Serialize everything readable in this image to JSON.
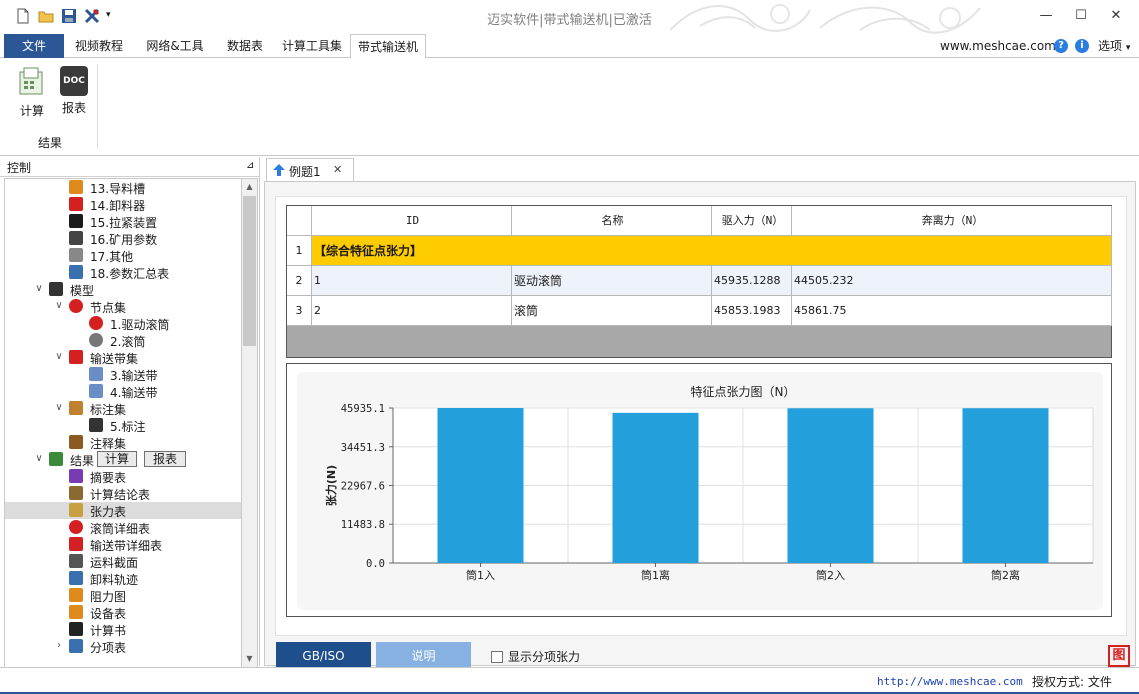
{
  "window": {
    "title": "迈实软件|带式输送机|已激活",
    "minimize": "—",
    "maximize": "☐",
    "close": "✕"
  },
  "ribbon": {
    "tabs": [
      "文件",
      "视频教程",
      "网络&工具",
      "数据表",
      "计算工具集",
      "带式输送机"
    ],
    "active_tab": "带式输送机",
    "website": "www.meshcae.com",
    "options_label": "选项",
    "options_arrow": "▾",
    "calc_label": "计算",
    "doc_label": "报表",
    "doc_icon_text": "DOC",
    "group_label": "结果"
  },
  "panel": {
    "title": "控制",
    "pin": "⊿",
    "tree": [
      {
        "label": "13.导料槽",
        "icon": "chute-icon"
      },
      {
        "label": "14.卸料器",
        "icon": "unloader-icon"
      },
      {
        "label": "15.拉紧装置",
        "icon": "tensioner-icon"
      },
      {
        "label": "16.矿用参数",
        "icon": "pickaxe-icon"
      },
      {
        "label": "17.其他",
        "icon": "diamond-icon"
      },
      {
        "label": "18.参数汇总表",
        "icon": "books-icon"
      },
      {
        "label": "模型",
        "icon": "grid-icon",
        "expander": "∨"
      },
      {
        "label": "节点集",
        "icon": "nodes-icon",
        "expander": "∨"
      },
      {
        "label": "1.驱动滚筒",
        "icon": "drive-pulley-icon"
      },
      {
        "label": "2.滚筒",
        "icon": "pulley-icon"
      },
      {
        "label": "输送带集",
        "icon": "belt-set-icon",
        "expander": "∨"
      },
      {
        "label": "3.输送带",
        "icon": "belt-icon"
      },
      {
        "label": "4.输送带",
        "icon": "belt-icon"
      },
      {
        "label": "标注集",
        "icon": "annotation-icon",
        "expander": "∨"
      },
      {
        "label": "5.标注",
        "icon": "dimension-icon"
      },
      {
        "label": "注释集",
        "icon": "note-icon"
      },
      {
        "label": "结果",
        "icon": "results-icon",
        "expander": "∨"
      },
      {
        "label": "摘要表",
        "icon": "summary-icon"
      },
      {
        "label": "计算结论表",
        "icon": "hammer-icon"
      },
      {
        "label": "张力表",
        "icon": "tension-icon"
      },
      {
        "label": "滚筒详细表",
        "icon": "red-circle-icon"
      },
      {
        "label": "输送带详细表",
        "icon": "red-bar-icon"
      },
      {
        "label": "运料截面",
        "icon": "section-icon"
      },
      {
        "label": "卸料轨迹",
        "icon": "trajectory-icon"
      },
      {
        "label": "阻力图",
        "icon": "resistance-icon"
      },
      {
        "label": "设备表",
        "icon": "equipment-icon"
      },
      {
        "label": "计算书",
        "icon": "pi-icon"
      },
      {
        "label": "分项表",
        "icon": "subtable-icon",
        "expander": "›"
      }
    ],
    "results_calc_btn": "计算",
    "results_report_btn": "报表",
    "selected_item": "张力表"
  },
  "document": {
    "tab_label": "例题1",
    "tab_close": "✕",
    "table": {
      "headers": [
        "ID",
        "名称",
        "驱入力（N）",
        "奔离力（N）"
      ],
      "rows": [
        {
          "num": "1",
          "id": "【综合特征点张力】",
          "name": "",
          "in": "",
          "out": ""
        },
        {
          "num": "2",
          "id": "1",
          "name": "驱动滚筒",
          "in": "45935.1288",
          "out": "44505.232"
        },
        {
          "num": "3",
          "id": "2",
          "name": "滚筒",
          "in": "45853.1983",
          "out": "45861.75"
        }
      ]
    },
    "gbiso_label": "GB/ISO",
    "explain_label": "说明",
    "show_sub_label": "显示分项张力",
    "corner_icon_text": "图"
  },
  "chart_data": {
    "type": "bar",
    "title": "特征点张力图（N）",
    "xlabel": "",
    "ylabel": "张力(N)",
    "categories": [
      "筒1入",
      "筒1离",
      "筒2入",
      "筒2离"
    ],
    "values": [
      45935.1288,
      44505.232,
      45853.1983,
      45861.75
    ],
    "yticks": [
      "0.0",
      "11483.8",
      "22967.6",
      "34451.3",
      "45935.1"
    ],
    "ylim": [
      0,
      45935.1
    ],
    "grid": true,
    "bar_color": "#239fdc"
  },
  "status": {
    "url": "http://www.meshcae.com",
    "auth": "授权方式: 文件"
  },
  "colors": {
    "accent": "#2b5797",
    "highlight_row": "#ffcc00",
    "bar": "#239fdc"
  }
}
